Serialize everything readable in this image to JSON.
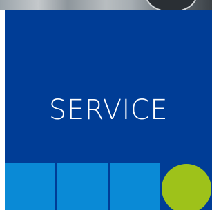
{
  "tile": {
    "title": "SERVICE"
  },
  "colors": {
    "tile_background": "#003d96",
    "square_color": "#0a8ad6",
    "circle_color": "#9ec21a",
    "title_color": "#ffffff"
  },
  "icons": {
    "decor_shapes": [
      "square",
      "square",
      "square",
      "circle"
    ]
  }
}
